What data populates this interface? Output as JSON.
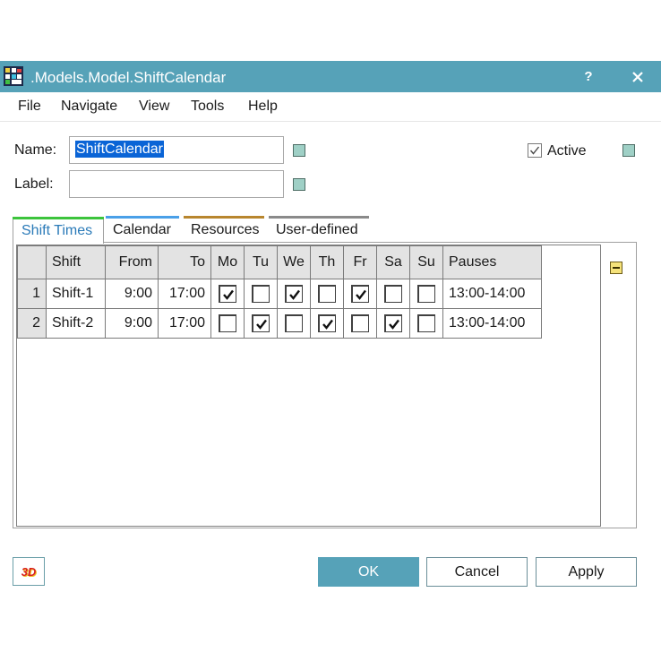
{
  "window": {
    "title": ".Models.Model.ShiftCalendar",
    "help_label": "?",
    "colors": {
      "titlebar": "#56a2b8",
      "accent": "#0a64d6"
    }
  },
  "menu": {
    "items": [
      "File",
      "Navigate",
      "View",
      "Tools",
      "Help"
    ]
  },
  "form": {
    "name_label": "Name:",
    "name_value": "ShiftCalendar",
    "label_label": "Label:",
    "label_value": "",
    "active_label": "Active",
    "active_checked": true
  },
  "tabs": [
    {
      "label": "Shift Times",
      "selected": true,
      "color": "#3cc43c"
    },
    {
      "label": "Calendar",
      "selected": false,
      "color": "#4aa0e8"
    },
    {
      "label": "Resources",
      "selected": false,
      "color": "#b8862e"
    },
    {
      "label": "User-defined",
      "selected": false,
      "color": "#8a8a8a"
    }
  ],
  "table": {
    "columns": [
      "",
      "Shift",
      "From",
      "To",
      "Mo",
      "Tu",
      "We",
      "Th",
      "Fr",
      "Sa",
      "Su",
      "Pauses"
    ],
    "rows": [
      {
        "num": "1",
        "shift": "Shift-1",
        "from": "9:00",
        "to": "17:00",
        "days": [
          true,
          false,
          true,
          false,
          true,
          false,
          false
        ],
        "pauses": "13:00-14:00"
      },
      {
        "num": "2",
        "shift": "Shift-2",
        "from": "9:00",
        "to": "17:00",
        "days": [
          false,
          true,
          false,
          true,
          false,
          true,
          false
        ],
        "pauses": "13:00-14:00"
      }
    ]
  },
  "buttons": {
    "three_d": "3D",
    "ok": "OK",
    "cancel": "Cancel",
    "apply": "Apply"
  }
}
